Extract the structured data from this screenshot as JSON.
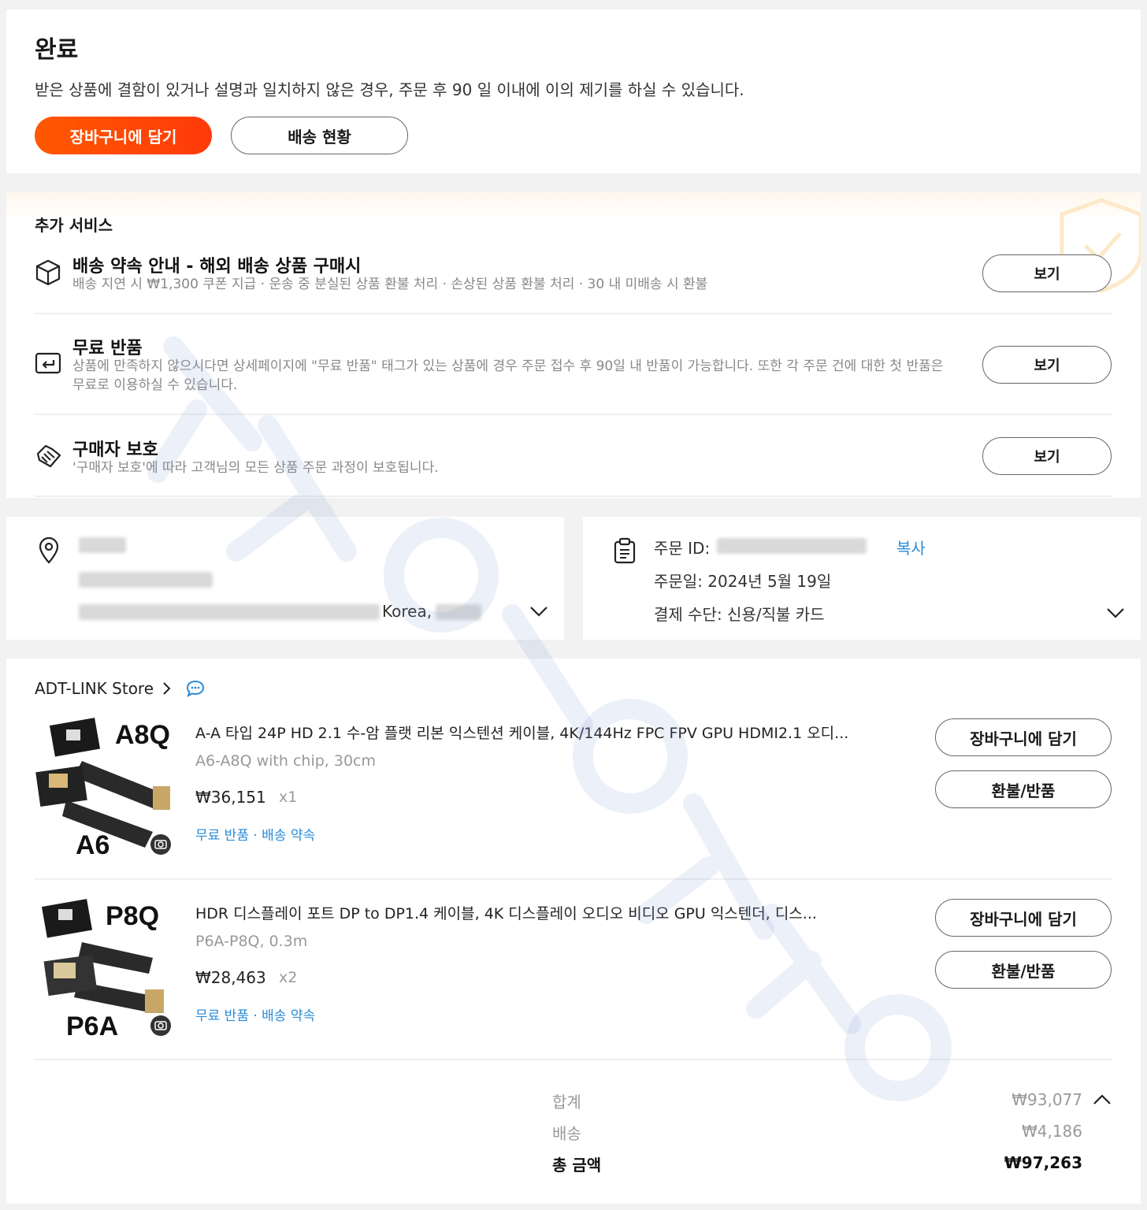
{
  "status": {
    "title": "완료",
    "description": "받은 상품에 결함이 있거나 설명과 일치하지 않은 경우, 주문 후 90 일 이내에 이의 제기를 하실 수 있습니다.",
    "add_to_cart_label": "장바구니에 담기",
    "tracking_label": "배송 현황"
  },
  "services": {
    "heading": "추가 서비스",
    "items": [
      {
        "icon": "box-icon",
        "title": "배송 약속 안내 - 해외 배송 상품 구매시",
        "desc": "배송 지연 시 ₩1,300 쿠폰 지급 · 운송 중 분실된 상품 환불 처리 · 손상된 상품 환불 처리 · 30 내 미배송 시 환불",
        "button": "보기"
      },
      {
        "icon": "return-icon",
        "title": "무료 반품",
        "desc": "상품에 만족하지 않으시다면 상세페이지에 \"무료 반품\" 태그가 있는 상품에 경우 주문 접수 후 90일 내 반품이 가능합니다. 또한 각 주문 건에 대한 첫 반품은 무료로 이용하실 수 있습니다.",
        "button": "보기"
      },
      {
        "icon": "handshake-icon",
        "title": "구매자 보호",
        "desc": "'구매자 보호'에 따라 고객님의 모든 상품 주문 과정이 보호됩니다.",
        "button": "보기"
      }
    ]
  },
  "address": {
    "country_suffix": "Korea,"
  },
  "order": {
    "id_label": "주문 ID:",
    "copy_label": "복사",
    "date_text": "주문일: 2024년 5월 19일",
    "payment_text": "결제 수단: 신용/직불 카드"
  },
  "store": {
    "name": "ADT-LINK Store"
  },
  "products": [
    {
      "title": "A-A 타입 24P HD 2.1 수-암 플랫 리본 익스텐션 케이블, 4K/144Hz FPC FPV GPU HDMI2.1 오디...",
      "variant": "A6-A8Q with chip, 30cm",
      "price": "₩36,151",
      "qty": "x1",
      "tags": "무료 반품 · 배송 약속",
      "thumb_top": "A8Q",
      "thumb_bottom": "A6",
      "cart_label": "장바구니에 담기",
      "refund_label": "환불/반품"
    },
    {
      "title": "HDR 디스플레이 포트 DP to DP1.4 케이블, 4K 디스플레이 오디오 비디오 GPU 익스텐더, 디스...",
      "variant": "P6A-P8Q, 0.3m",
      "price": "₩28,463",
      "qty": "x2",
      "tags": "무료 반품 · 배송 약속",
      "thumb_top": "P8Q",
      "thumb_bottom": "P6A",
      "cart_label": "장바구니에 담기",
      "refund_label": "환불/반품"
    }
  ],
  "summary": {
    "subtotal_label": "합계",
    "subtotal_value": "₩93,077",
    "shipping_label": "배송",
    "shipping_value": "₩4,186",
    "total_label": "총 금액",
    "total_value": "₩97,263"
  },
  "colors": {
    "primary": "#ff4a00",
    "link": "#2b8bd6",
    "muted": "#888888"
  }
}
